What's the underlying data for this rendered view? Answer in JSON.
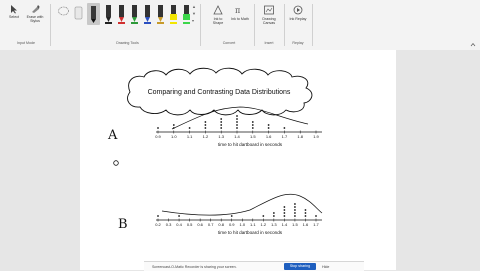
{
  "ribbon": {
    "select_label": "Select",
    "erase_label": "Erase with Stylus",
    "input_mode_group": "Input Mode",
    "drawing_tools_group": "Drawing Tools",
    "ink_to_shape_label": "Ink to Shape",
    "ink_to_math_label": "Ink to Math",
    "convert_group": "Convert",
    "drawing_canvas_label": "Drawing Canvas",
    "insert_group": "Insert",
    "ink_replay_label": "Ink Replay",
    "replay_group": "Replay",
    "pens": [
      {
        "name": "pen-black-icon",
        "color": "#222222"
      },
      {
        "name": "pen-red-icon",
        "color": "#d03030"
      },
      {
        "name": "pen-green-icon",
        "color": "#2e9a3a"
      },
      {
        "name": "pen-blue-icon",
        "color": "#2a4fc0"
      },
      {
        "name": "pen-gold-icon",
        "color": "#c79a2a"
      },
      {
        "name": "highlighter-yellow-icon",
        "color": "#f2e600"
      },
      {
        "name": "highlighter-green-icon",
        "color": "#3bd64a"
      }
    ]
  },
  "slide": {
    "title": "Comparing and Contrasting Data Distributions",
    "handwritten_a": "A",
    "handwritten_b": "B",
    "plot_a": {
      "ticks": [
        "0.9",
        "1.0",
        "1.1",
        "1.2",
        "1.3",
        "1.4",
        "1.5",
        "1.6",
        "1.7",
        "1.8",
        "1.9"
      ],
      "dots": [
        1,
        2,
        1,
        3,
        4,
        5,
        3,
        2,
        1,
        0,
        0
      ],
      "axis_label": "time to hit dartboard in seconds"
    },
    "plot_b": {
      "ticks": [
        "0.2",
        "0.3",
        "0.4",
        "0.5",
        "0.6",
        "0.7",
        "0.8",
        "0.9",
        "1.0",
        "1.1",
        "1.2",
        "1.3",
        "1.4",
        "1.5",
        "1.6",
        "1.7"
      ],
      "dots": [
        1,
        0,
        1,
        0,
        0,
        0,
        0,
        1,
        0,
        0,
        1,
        2,
        4,
        5,
        3,
        1
      ],
      "axis_label": "time to hit dartboard in seconds"
    }
  },
  "toast": {
    "message": "Screencast-O-Matic Recorder is sharing your screen.",
    "stop_label": "Stop sharing",
    "hide_label": "Hide"
  }
}
